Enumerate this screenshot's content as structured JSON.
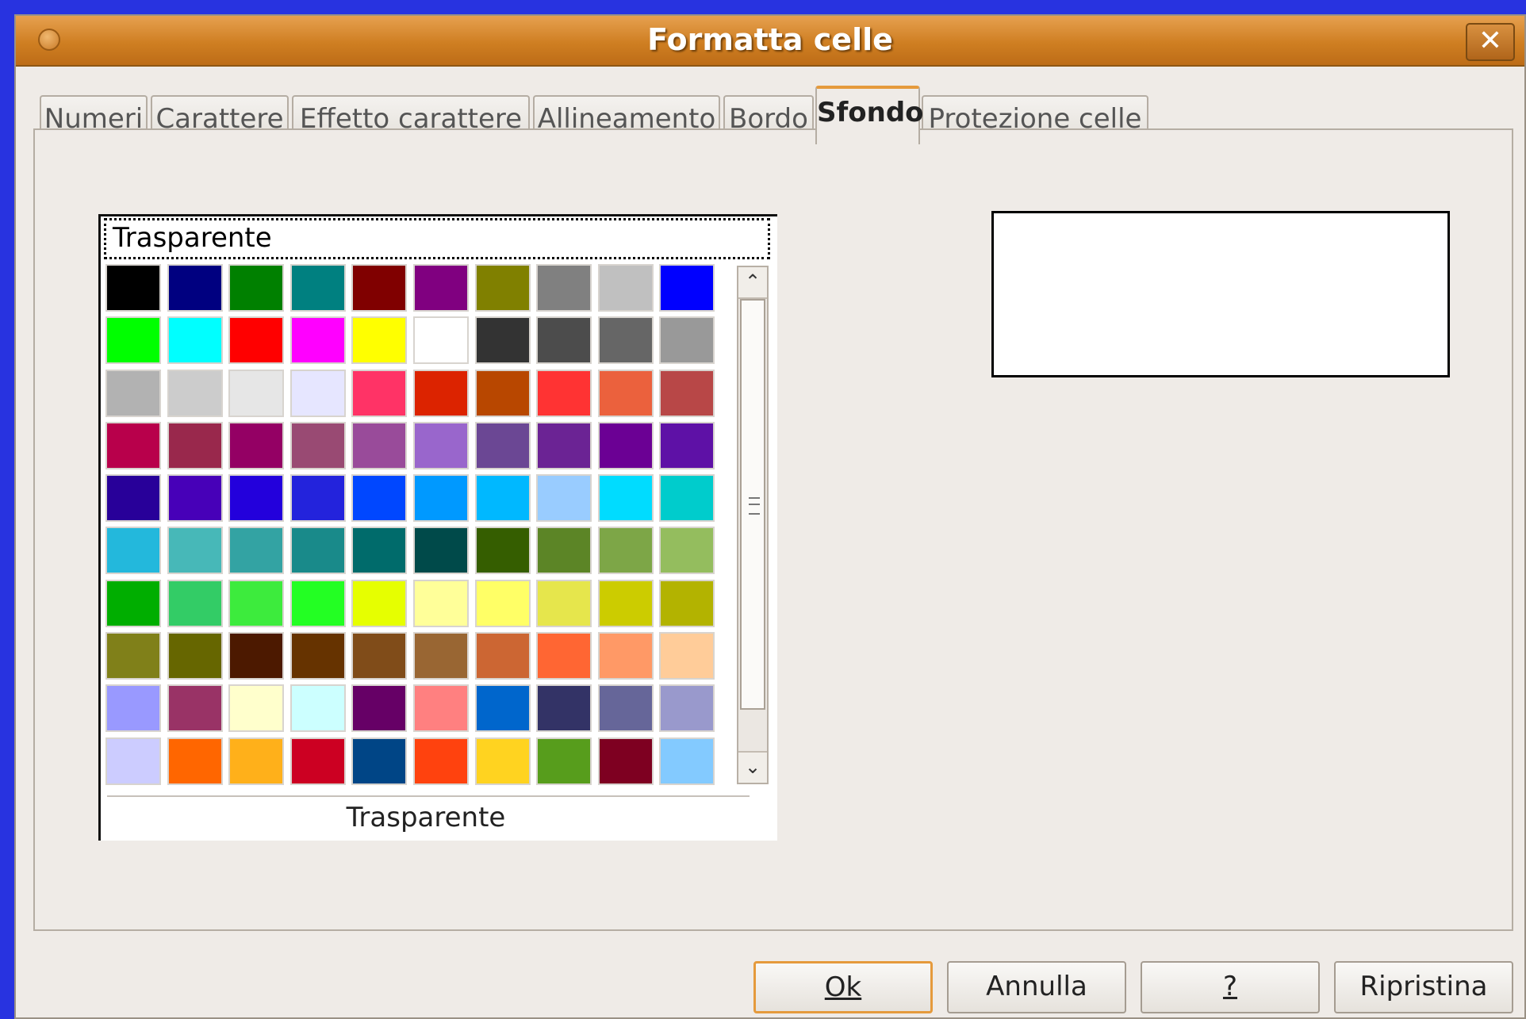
{
  "window": {
    "title": "Formatta celle",
    "close_label": "✕"
  },
  "tabs": [
    {
      "label": "Numeri"
    },
    {
      "label": "Carattere"
    },
    {
      "label": "Effetto carattere"
    },
    {
      "label": "Allineamento"
    },
    {
      "label": "Bordo"
    },
    {
      "label": "Sfondo",
      "active": true
    },
    {
      "label": "Protezione celle"
    }
  ],
  "background": {
    "selected_color_name": "Trasparente",
    "color_label": "Trasparente",
    "swatches": [
      [
        "#000000",
        "#000080",
        "#008000",
        "#008080",
        "#800000",
        "#800080",
        "#808000",
        "#808080",
        "#c0c0c0",
        "#0000ff"
      ],
      [
        "#00ff00",
        "#00ffff",
        "#ff0000",
        "#ff00ff",
        "#ffff00",
        "#ffffff",
        "#333333",
        "#4c4c4c",
        "#666666",
        "#999999"
      ],
      [
        "#b2b2b2",
        "#cccccc",
        "#e6e6e6",
        "#e6e6ff",
        "#ff3366",
        "#dc2300",
        "#b84700",
        "#ff3333",
        "#eb613d",
        "#b84747"
      ],
      [
        "#b8004b",
        "#99284c",
        "#940064",
        "#994a73",
        "#994b9a",
        "#9966cc",
        "#6b4794",
        "#6b2394",
        "#6b0094",
        "#5e11a6"
      ],
      [
        "#280099",
        "#4700b8",
        "#2300dc",
        "#2323dc",
        "#0047ff",
        "#0099ff",
        "#00b8ff",
        "#99ccff",
        "#00dcff",
        "#00cccc"
      ],
      [
        "#23b8dc",
        "#47b8b8",
        "#33a3a3",
        "#198a8a",
        "#006b6b",
        "#004a4a",
        "#355e00",
        "#5c8526",
        "#7da647",
        "#94bd5e"
      ],
      [
        "#00ae00",
        "#33cc66",
        "#3deb3d",
        "#23ff23",
        "#e6ff00",
        "#ffff99",
        "#ffff66",
        "#e6e64c",
        "#cccc00",
        "#b3b300"
      ],
      [
        "#808019",
        "#666600",
        "#4c1900",
        "#663300",
        "#804c19",
        "#996633",
        "#cc6633",
        "#ff6633",
        "#ff9966",
        "#ffcc99"
      ],
      [
        "#9999ff",
        "#993366",
        "#ffffcc",
        "#ccffff",
        "#660066",
        "#ff8080",
        "#0066cc",
        "#333366",
        "#666699",
        "#9999cc"
      ],
      [
        "#ccccff",
        "#ff6600",
        "#ffb01a",
        "#cc0022",
        "#004586",
        "#ff420e",
        "#ffd320",
        "#579d1c",
        "#7e0021",
        "#83caff"
      ]
    ]
  },
  "buttons": {
    "ok": "Ok",
    "cancel": "Annulla",
    "help": "?",
    "reset": "Ripristina"
  },
  "scrollbar": {
    "up_icon": "chevron-up",
    "down_icon": "chevron-down"
  }
}
